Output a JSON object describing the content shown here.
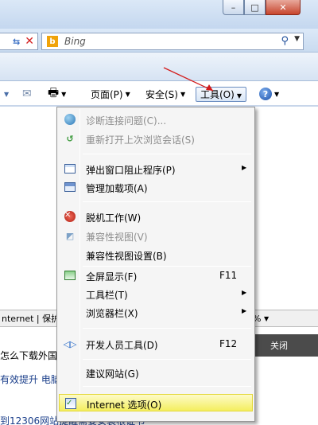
{
  "window": {
    "minimize_glyph": "–",
    "maximize_glyph": "□",
    "close_glyph": "✕"
  },
  "search": {
    "engine": "Bing",
    "engine_logo": "b"
  },
  "command_bar": {
    "page_label": "页面(P)",
    "safety_label": "安全(S)",
    "tools_label": "工具(O)",
    "help_glyph": "?"
  },
  "status": {
    "zone": "nternet | 保护",
    "zoom": "%"
  },
  "background_page": {
    "close_label": "关闭",
    "link1": "怎么下载外国",
    "link2": "有效提升 电脑",
    "link3": "到12306网站提醒需要安装根证书"
  },
  "tools_menu": {
    "items": [
      {
        "label": "诊断连接问题(C)...",
        "shortcut": "",
        "submenu": false,
        "disabled": true,
        "icon": "globe-icon"
      },
      {
        "label": "重新打开上次浏览会话(S)",
        "shortcut": "",
        "submenu": false,
        "disabled": true,
        "icon": "reopen-icon"
      },
      {
        "label": "弹出窗口阻止程序(P)",
        "shortcut": "",
        "submenu": true,
        "disabled": false,
        "icon": "popup-blocker-icon"
      },
      {
        "label": "管理加载项(A)",
        "shortcut": "",
        "submenu": false,
        "disabled": false,
        "icon": "addons-icon"
      },
      {
        "label": "脱机工作(W)",
        "shortcut": "",
        "submenu": false,
        "disabled": false,
        "icon": "offline-icon"
      },
      {
        "label": "兼容性视图(V)",
        "shortcut": "",
        "submenu": false,
        "disabled": true,
        "icon": "compat-view-icon"
      },
      {
        "label": "兼容性视图设置(B)",
        "shortcut": "",
        "submenu": false,
        "disabled": false,
        "icon": ""
      },
      {
        "label": "全屏显示(F)",
        "shortcut": "F11",
        "submenu": false,
        "disabled": false,
        "icon": "fullscreen-icon"
      },
      {
        "label": "工具栏(T)",
        "shortcut": "",
        "submenu": true,
        "disabled": false,
        "icon": ""
      },
      {
        "label": "浏览器栏(X)",
        "shortcut": "",
        "submenu": true,
        "disabled": false,
        "icon": ""
      },
      {
        "label": "开发人员工具(D)",
        "shortcut": "F12",
        "submenu": false,
        "disabled": false,
        "icon": "developer-tools-icon"
      },
      {
        "label": "建议网站(G)",
        "shortcut": "",
        "submenu": false,
        "disabled": false,
        "icon": ""
      },
      {
        "label": "Internet 选项(O)",
        "shortcut": "",
        "submenu": false,
        "disabled": false,
        "icon": "internet-options-icon",
        "highlighted": true
      }
    ]
  }
}
